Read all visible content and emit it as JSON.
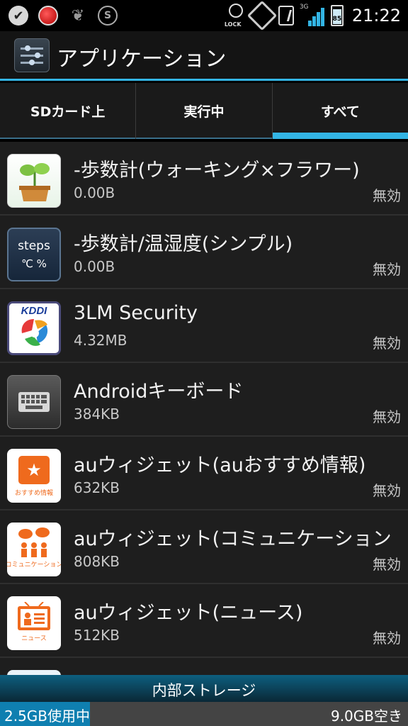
{
  "status_bar": {
    "time": "21:22",
    "battery_level": "85",
    "network": "3G",
    "lock_label": "LOCK",
    "skype_letter": "S",
    "check_icon": "✔",
    "leaf_icon": "leaf-icon"
  },
  "action_bar": {
    "title": "アプリケーション",
    "icon": "settings-sliders-icon"
  },
  "tabs": [
    {
      "label": "SDカード上",
      "active": false
    },
    {
      "label": "実行中",
      "active": false
    },
    {
      "label": "すべて",
      "active": true
    }
  ],
  "apps": [
    {
      "name": "-歩数計(ウォーキング×フラワー)",
      "size": "0.00B",
      "status": "無効",
      "icon": "plant-icon"
    },
    {
      "name": "-歩数計/温湿度(シンプル)",
      "size": "0.00B",
      "status": "無効",
      "icon": "steps-icon",
      "icon_text_1": "steps",
      "icon_text_2": "℃ %"
    },
    {
      "name": "3LM Security",
      "size": "4.32MB",
      "status": "無効",
      "icon": "kddi-icon",
      "icon_text_1": "KDDI"
    },
    {
      "name": "Androidキーボード",
      "size": "384KB",
      "status": "無効",
      "icon": "keyboard-icon"
    },
    {
      "name": "auウィジェット(auおすすめ情報)",
      "size": "632KB",
      "status": "無効",
      "icon": "star-icon",
      "icon_label": "おすすめ情報",
      "icon_glyph": "★"
    },
    {
      "name": "auウィジェット(コミュニケーション",
      "size": "808KB",
      "status": "無効",
      "icon": "communication-icon",
      "icon_label": "コミュニケーション"
    },
    {
      "name": "auウィジェット(ニュース)",
      "size": "512KB",
      "status": "無効",
      "icon": "news-icon",
      "icon_label": "ニュース"
    }
  ],
  "storage": {
    "title": "内部ストレージ",
    "used_text": "2.5GB使用中",
    "free_text": "9.0GB空き",
    "used_fraction": 0.22
  },
  "colors": {
    "accent": "#33b5e5",
    "au_orange": "#ef6a1d"
  }
}
